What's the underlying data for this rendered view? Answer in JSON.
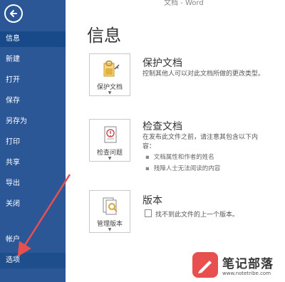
{
  "window": {
    "title": "文档 - Word"
  },
  "sidebar": {
    "items": [
      {
        "label": "信息"
      },
      {
        "label": "新建"
      },
      {
        "label": "打开"
      },
      {
        "label": "保存"
      },
      {
        "label": "另存为"
      },
      {
        "label": "打印"
      },
      {
        "label": "共享"
      },
      {
        "label": "导出"
      },
      {
        "label": "关闭"
      },
      {
        "label": "帐户"
      },
      {
        "label": "选项"
      }
    ]
  },
  "main": {
    "title": "信息",
    "protect": {
      "button_label": "保护文档",
      "title": "保护文档",
      "description": "控制其他人可以对此文档所做的更改类型。"
    },
    "inspect": {
      "button_label": "检查问题",
      "title": "检查文档",
      "description": "在发布此文件之前，请注意其包含以下内容：",
      "bullets": [
        "文档属性和作者的姓名",
        "残障人士无法阅读的内容"
      ]
    },
    "versions": {
      "button_label": "管理版本",
      "title": "版本",
      "description": "找不到此文件的上一个版本。"
    }
  },
  "watermark": {
    "brand": "笔记部落",
    "url": "www.notetribe.com"
  },
  "colors": {
    "sidebar": "#2b5797",
    "arrow": "#e8504f",
    "watermark_badge": "#e8504f"
  },
  "icons": {
    "back": "back-arrow-icon",
    "protect": "lock-key-icon",
    "inspect": "document-check-icon",
    "versions": "document-search-icon"
  }
}
